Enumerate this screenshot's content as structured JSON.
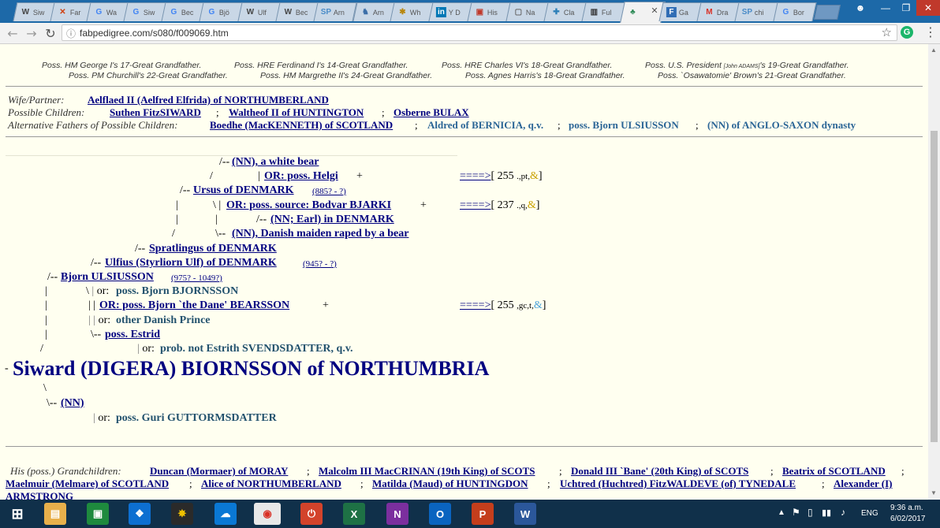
{
  "browser": {
    "tabs": [
      {
        "label": "Siw",
        "icon": "W",
        "color": "#444",
        "bg": "transparent"
      },
      {
        "label": "Far",
        "icon": "✕",
        "color": "#d04010",
        "bg": "transparent"
      },
      {
        "label": "Wa",
        "icon": "G",
        "color": "#4285f4",
        "bg": "transparent"
      },
      {
        "label": "Siw",
        "icon": "G",
        "color": "#4285f4",
        "bg": "transparent"
      },
      {
        "label": "Bec",
        "icon": "G",
        "color": "#4285f4",
        "bg": "transparent"
      },
      {
        "label": "Bjö",
        "icon": "G",
        "color": "#4285f4",
        "bg": "transparent"
      },
      {
        "label": "Ulf",
        "icon": "W",
        "color": "#444",
        "bg": "transparent"
      },
      {
        "label": "Bec",
        "icon": "W",
        "color": "#444",
        "bg": "transparent"
      },
      {
        "label": "Arn",
        "icon": "SP",
        "color": "#4a8cc8",
        "bg": "transparent"
      },
      {
        "label": "Arn",
        "icon": "♞",
        "color": "#3b6ea8",
        "bg": "transparent"
      },
      {
        "label": "Wh",
        "icon": "✱",
        "color": "#b8860b",
        "bg": "transparent"
      },
      {
        "label": "Y D",
        "icon": "in",
        "color": "#fff",
        "bg": "#0077b5"
      },
      {
        "label": "His",
        "icon": "▣",
        "color": "#c0392b",
        "bg": "transparent"
      },
      {
        "label": "Na",
        "icon": "▢",
        "color": "#666",
        "bg": "transparent"
      },
      {
        "label": "Cla",
        "icon": "✚",
        "color": "#2c7fb8",
        "bg": "transparent"
      },
      {
        "label": "Ful",
        "icon": "▥",
        "color": "#333",
        "bg": "transparent"
      },
      {
        "label": "",
        "icon": "♣",
        "color": "#2e8b57",
        "bg": "transparent",
        "active": true
      },
      {
        "label": "Ga",
        "icon": "F",
        "color": "#fff",
        "bg": "#2f6db5"
      },
      {
        "label": "Dra",
        "icon": "M",
        "color": "#d93025",
        "bg": "transparent"
      },
      {
        "label": "chi",
        "icon": "SP",
        "color": "#4a8cc8",
        "bg": "transparent"
      },
      {
        "label": "Bor",
        "icon": "G",
        "color": "#4285f4",
        "bg": "transparent"
      }
    ],
    "url": "fabpedigree.com/s080/f009069.htm"
  },
  "page": {
    "poss_row1": [
      "Poss. HM George I's 17-Great Grandfather.",
      "Poss. HRE Ferdinand I's 14-Great Grandfather.",
      "Poss. HRE Charles VI's 18-Great Grandfather."
    ],
    "poss_adams_prefix": "Poss. U.S. President ",
    "poss_adams_small": "[John ADAMS]",
    "poss_adams_suffix": "'s 19-Great Grandfather.",
    "poss_row2": [
      "Poss. PM Churchill's 22-Great Grandfather.",
      "Poss. HM Margrethe II's 24-Great Grandfather.",
      "Poss. Agnes Harris's 18-Great Grandfather.",
      "Poss. `Osawatomie' Brown's 21-Great Grandfather."
    ],
    "wife_label": "Wife/Partner:",
    "wife": "Aelflaed II (Aelfred Elfrida) of NORTHUMBERLAND",
    "children_label": "Possible Children:",
    "children": [
      "Suthen FitzSIWARD",
      "Waltheof II of HUNTINGTON",
      "Osberne BULAX"
    ],
    "alt_label": "Alternative Fathers of Possible Children:",
    "alt_1": "Boedhe (MacKENNETH) of SCOTLAND",
    "alt_2": "Aldred of BERNICIA, q.v.",
    "alt_3": "poss. Bjorn ULSIUSSON",
    "alt_4": "(NN) of ANGLO-SAXON dynasty",
    "tree": {
      "white_bear": "(NN), a white bear",
      "helgi": "OR: poss. Helgi",
      "ursus": "Ursus of DENMARK",
      "ursus_years": "(885? - ?)",
      "bodvar": "OR: poss. source: Bodvar BJARKI",
      "nn_earl": "(NN; Earl) in DENMARK",
      "danish_maiden": "(NN), Danish maiden raped by a bear",
      "spratlingus": "Spratlingus of DENMARK",
      "ulfius": "Ulfius (Styrliorn Ulf) of DENMARK",
      "ulfius_years": "(945? - ?)",
      "bjorn": "Bjorn ULSIUSSON",
      "bjorn_years": "(975? - 1049?)",
      "bjornsson": "poss. Bjorn BJORNSSON",
      "bearsson": "OR: poss. Bjorn `the Dane' BEARSSON",
      "other_prince": "other Danish Prince",
      "estrid": "poss.  Estrid",
      "estrith": "prob. not Estrith SVENDSDATTER, q.v.",
      "subject": "Siward (DIGERA) BIORNSSON of NORTHUMBRIA",
      "mother": "(NN)",
      "guri": "poss. Guri GUTTORMSDATTER",
      "or_word": "or:",
      "ref1": {
        "num": "255",
        "codes": ".,pt,"
      },
      "ref2": {
        "num": "237",
        "codes": ".,q,"
      },
      "ref3": {
        "num": "255",
        "codes": ",gc,t,"
      },
      "arrow": "====>",
      "amp": "&"
    },
    "grand_label": "His (poss.) Grandchildren:",
    "grand": [
      "Duncan (Mormaer) of MORAY",
      "Malcolm III MacCRINAN (19th King) of SCOTS",
      "Donald III `Bane' (20th King) of SCOTS",
      "Beatrix of SCOTLAND",
      "Maelmuir (Melmare) of SCOTLAND",
      "Alice of NORTHUMBERLAND",
      "Matilda (Maud) of HUNTINGDON",
      "Uchtred (Huchtred) FitzWALDEVE (of) TYNEDALE",
      "Alexander (I)"
    ],
    "grand_last": "ARMSTRONG"
  },
  "taskbar": {
    "lang": "ENG",
    "time": "9:36 a.m.",
    "date": "6/02/2017"
  }
}
